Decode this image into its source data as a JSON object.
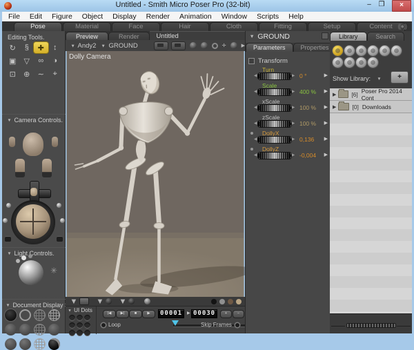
{
  "window": {
    "title": "Untitled - Smith Micro Poser Pro  (32-bit)",
    "minimize_glyph": "–",
    "maximize_glyph": "❐",
    "close_glyph": "×"
  },
  "menu_bar": {
    "items": [
      "File",
      "Edit",
      "Figure",
      "Object",
      "Display",
      "Render",
      "Animation",
      "Window",
      "Scripts",
      "Help"
    ]
  },
  "room_tabs": {
    "tabs": [
      "Pose",
      "Material",
      "Face",
      "Hair",
      "Cloth",
      "Fitting",
      "Setup",
      "Content"
    ],
    "active": "Pose"
  },
  "left_panel": {
    "editing_tools": {
      "title": "Editing Tools.",
      "tools": [
        {
          "name": "rotate",
          "glyph": "↻"
        },
        {
          "name": "twist",
          "glyph": "§"
        },
        {
          "name": "translate-pull",
          "glyph": "✚"
        },
        {
          "name": "translate-in-out",
          "glyph": "↕"
        },
        {
          "name": "scale",
          "glyph": "▣"
        },
        {
          "name": "taper",
          "glyph": "▽"
        },
        {
          "name": "chain-break",
          "glyph": "∞"
        },
        {
          "name": "color",
          "glyph": "◑"
        },
        {
          "name": "grouping",
          "glyph": "⊡"
        },
        {
          "name": "view-magnifier",
          "glyph": "⊕"
        },
        {
          "name": "morphing-tool",
          "glyph": "∼"
        },
        {
          "name": "direct-manipulation",
          "glyph": "⌖"
        }
      ]
    },
    "camera_controls": {
      "title": "Camera Controls."
    },
    "light_controls": {
      "title": "Light Controls."
    },
    "display_styles": {
      "title": "Document Display S"
    }
  },
  "document": {
    "tab_preview": "Preview",
    "tab_render": "Render",
    "doc_title": "Untitled",
    "figure_menu": "Andy2",
    "actor_menu": "GROUND",
    "camera_label": "Dolly Camera"
  },
  "parameters_panel": {
    "header": "GROUND",
    "tab_parameters": "Parameters",
    "tab_properties": "Properties",
    "section_title": "Transform",
    "params": [
      {
        "name": "Turn",
        "value": "0 °",
        "label_color": "#c9b233",
        "value_color": "#d78c2a"
      },
      {
        "name": "Scale",
        "value": "400 %",
        "label_color": "#8ac43f",
        "value_color": "#8ac43f"
      },
      {
        "name": "xScale",
        "value": "100 %",
        "label_color": "#c2c2c2",
        "value_color": "#b09a66"
      },
      {
        "name": "zScale",
        "value": "100 %",
        "label_color": "#c2c2c2",
        "value_color": "#b09a66"
      },
      {
        "name": "DollyX",
        "value": "0,136",
        "label_color": "#d79a3c",
        "value_color": "#d78c2a"
      },
      {
        "name": "DollyZ",
        "value": "-0,004",
        "label_color": "#d79a3c",
        "value_color": "#d78c2a"
      }
    ]
  },
  "library_panel": {
    "tab_library": "Library",
    "tab_search": "Search",
    "show_library_label": "Show Library:",
    "add_button_glyph": "+",
    "items": [
      {
        "count": "[6]",
        "label": "Poser Pro 2014 Cont"
      },
      {
        "count": "[0]",
        "label": "Downloads"
      }
    ]
  },
  "animation": {
    "ui_dots_label": "UI Dots",
    "transport": [
      "|◀",
      "▶|",
      "■",
      "▶"
    ],
    "frame_current": "00001",
    "frame_end": "00030",
    "plus_glyph": "+",
    "minus_glyph": "−",
    "loop_label": "Loop",
    "skip_frames_label": "Skip Frames"
  },
  "colors": {
    "viewport_bg": "#6f6760",
    "viewport_floor": "#877d6f",
    "highlight_yellow": "#e8c832",
    "titlebar_blue": "#a6c9e9",
    "close_red": "#c14a4a",
    "fg_dot_colors": [
      "#141414",
      "#8f8f8f",
      "#6e5844",
      "#baa584"
    ]
  }
}
